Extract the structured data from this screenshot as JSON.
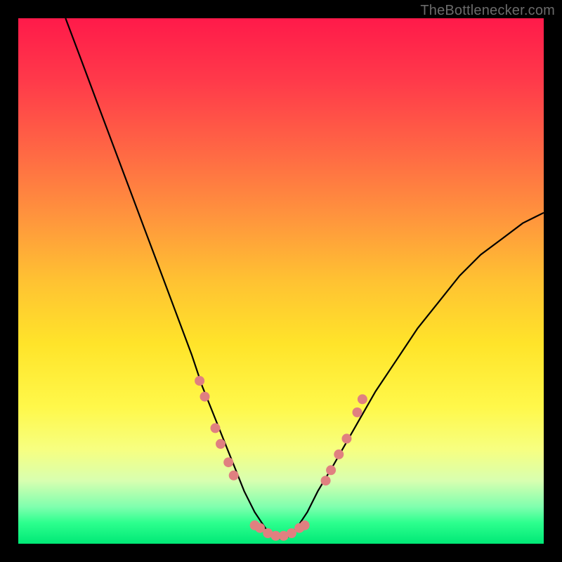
{
  "watermark": "TheBottlenecker.com",
  "chart_data": {
    "type": "line",
    "title": "",
    "xlabel": "",
    "ylabel": "",
    "xlim": [
      0,
      100
    ],
    "ylim": [
      0,
      100
    ],
    "series": [
      {
        "name": "bottleneck-curve",
        "x": [
          9,
          12,
          15,
          18,
          21,
          24,
          27,
          30,
          33,
          35,
          37,
          39,
          41,
          43,
          45,
          47,
          49,
          51,
          53,
          55,
          57,
          60,
          64,
          68,
          72,
          76,
          80,
          84,
          88,
          92,
          96,
          100
        ],
        "y": [
          100,
          92,
          84,
          76,
          68,
          60,
          52,
          44,
          36,
          30,
          25,
          20,
          15,
          10,
          6,
          3,
          1,
          1,
          3,
          6,
          10,
          15,
          22,
          29,
          35,
          41,
          46,
          51,
          55,
          58,
          61,
          63
        ]
      }
    ],
    "markers": [
      {
        "x": 34.5,
        "y": 31
      },
      {
        "x": 35.5,
        "y": 28
      },
      {
        "x": 37.5,
        "y": 22
      },
      {
        "x": 38.5,
        "y": 19
      },
      {
        "x": 40.0,
        "y": 15.5
      },
      {
        "x": 41.0,
        "y": 13
      },
      {
        "x": 45.0,
        "y": 3.5
      },
      {
        "x": 46.0,
        "y": 3
      },
      {
        "x": 47.5,
        "y": 2
      },
      {
        "x": 49.0,
        "y": 1.5
      },
      {
        "x": 50.5,
        "y": 1.5
      },
      {
        "x": 52.0,
        "y": 2
      },
      {
        "x": 53.5,
        "y": 3
      },
      {
        "x": 54.5,
        "y": 3.5
      },
      {
        "x": 58.5,
        "y": 12
      },
      {
        "x": 59.5,
        "y": 14
      },
      {
        "x": 61.0,
        "y": 17
      },
      {
        "x": 62.5,
        "y": 20
      },
      {
        "x": 64.5,
        "y": 25
      },
      {
        "x": 65.5,
        "y": 27.5
      }
    ],
    "marker_color": "#e08080",
    "curve_color": "#000000",
    "background_gradient": [
      "#ff1a4a",
      "#ffe42a",
      "#00e876"
    ]
  }
}
